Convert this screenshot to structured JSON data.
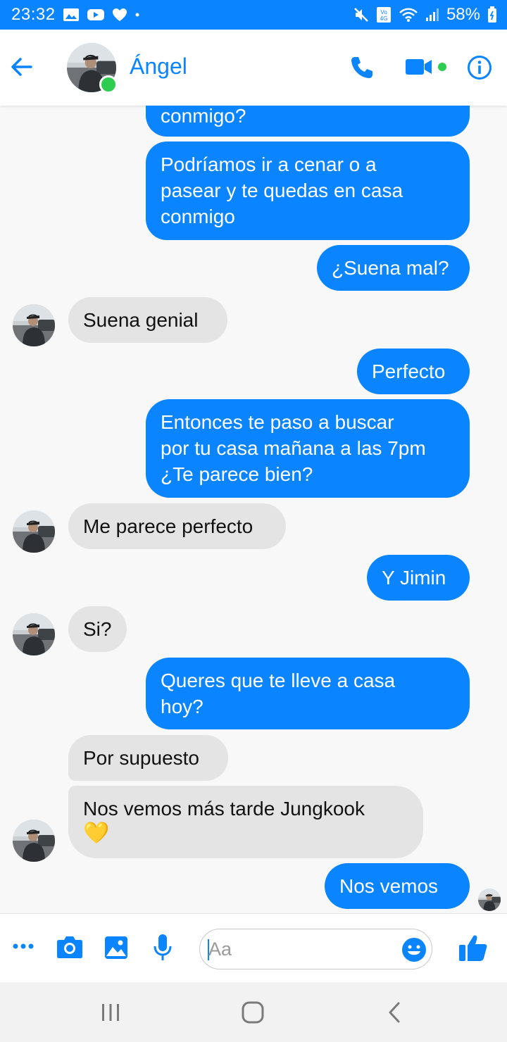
{
  "status_bar": {
    "time": "23:32",
    "battery": "58%",
    "network": "4G",
    "icons": [
      "gallery-icon",
      "youtube-icon",
      "heart-icon",
      "dot-icon",
      "mute-icon",
      "volte-icon",
      "wifi-icon",
      "signal-icon",
      "battery-icon"
    ]
  },
  "header": {
    "contact_name": "Ángel",
    "online": true,
    "icons": [
      "back-arrow-icon",
      "phone-icon",
      "video-camera-icon",
      "info-icon"
    ]
  },
  "messages": [
    {
      "from": "me",
      "text": "conmigo?"
    },
    {
      "from": "me",
      "lines": [
        "Podríamos ir a cenar o a",
        "pasear y te quedas en casa",
        "conmigo"
      ]
    },
    {
      "from": "me",
      "text": "¿Suena mal?"
    },
    {
      "from": "contact",
      "text": "Suena genial"
    },
    {
      "from": "me",
      "text": "Perfecto"
    },
    {
      "from": "me",
      "lines": [
        "Entonces te paso a buscar",
        "por tu casa mañana a las 7pm",
        "¿Te parece bien?"
      ]
    },
    {
      "from": "contact",
      "text": "Me parece perfecto"
    },
    {
      "from": "me",
      "text": "Y Jimin"
    },
    {
      "from": "contact",
      "text": "Si?"
    },
    {
      "from": "me",
      "lines": [
        "Queres que te lleve a casa",
        "hoy?"
      ]
    },
    {
      "from": "contact",
      "text": "Por supuesto"
    },
    {
      "from": "contact",
      "lines": [
        "Nos vemos más tarde Jungkook",
        "💛"
      ]
    },
    {
      "from": "me",
      "text": "Nos vemos"
    }
  ],
  "composer": {
    "placeholder": "Aa",
    "icons": [
      "more-icon",
      "camera-icon",
      "image-icon",
      "microphone-icon",
      "emoji-icon",
      "thumbs-up-icon"
    ]
  },
  "colors": {
    "accent": "#0a84ff",
    "outgoing_bubble": "#0a84ff",
    "incoming_bubble": "#e4e4e4",
    "online": "#2ecc4f"
  }
}
